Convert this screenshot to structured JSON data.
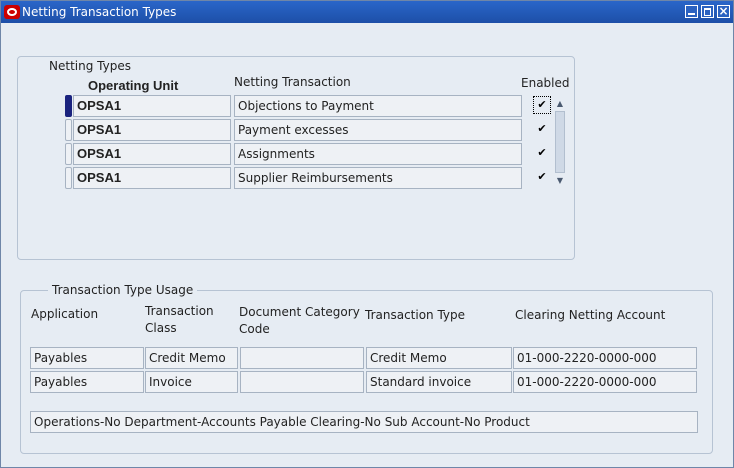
{
  "window": {
    "title": "Netting Transaction Types"
  },
  "netting_types": {
    "group_title": "Netting Types",
    "headers": {
      "operating_unit": "Operating Unit",
      "netting_transaction": "Netting Transaction",
      "enabled": "Enabled"
    },
    "rows": [
      {
        "operating_unit": "OPSA1",
        "netting_transaction": "Objections to Payment",
        "enabled": true,
        "selected": true
      },
      {
        "operating_unit": "OPSA1",
        "netting_transaction": "Payment excesses",
        "enabled": true,
        "selected": false
      },
      {
        "operating_unit": "OPSA1",
        "netting_transaction": "Assignments",
        "enabled": true,
        "selected": false
      },
      {
        "operating_unit": "OPSA1",
        "netting_transaction": "Supplier Reimbursements",
        "enabled": true,
        "selected": false
      }
    ]
  },
  "usage": {
    "group_title": "Transaction Type Usage",
    "headers": {
      "application": "Application",
      "transaction_class_1": "Transaction",
      "transaction_class_2": "Class",
      "doc_category_1": "Document Category",
      "doc_category_2": "Code",
      "transaction_type": "Transaction Type",
      "clearing_account": "Clearing Netting Account"
    },
    "rows": [
      {
        "application": "Payables",
        "transaction_class": "Credit Memo",
        "doc_category": "",
        "transaction_type": "Credit Memo",
        "clearing_account": "01-000-2220-0000-000"
      },
      {
        "application": "Payables",
        "transaction_class": "Invoice",
        "doc_category": "",
        "transaction_type": "Standard invoice",
        "clearing_account": "01-000-2220-0000-000"
      }
    ],
    "account_description": "Operations-No Department-Accounts Payable Clearing-No Sub Account-No Product"
  }
}
